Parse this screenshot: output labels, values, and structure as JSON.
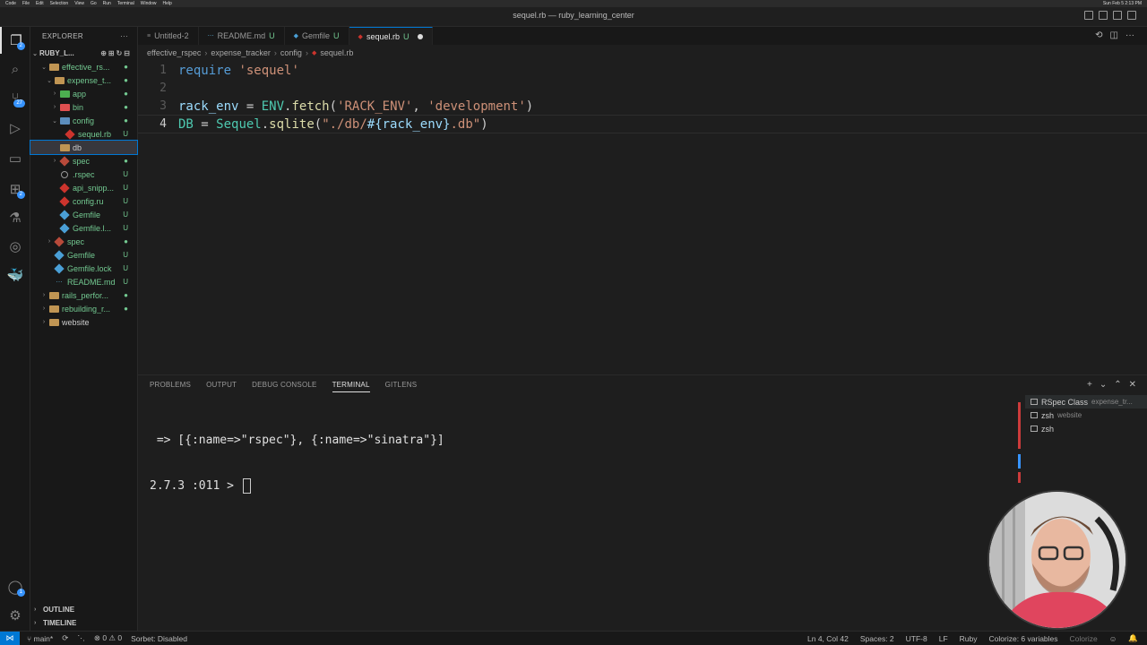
{
  "window": {
    "title": "sequel.rb — ruby_learning_center"
  },
  "menubar": {
    "items": [
      "Code",
      "File",
      "Edit",
      "Selection",
      "View",
      "Go",
      "Run",
      "Terminal",
      "Window",
      "Help"
    ],
    "clock": "Sun Feb 5 2:13 PM"
  },
  "activity": {
    "explorer_badge": "2",
    "scm_badge": "27",
    "accounts_badge": "1"
  },
  "sidebar": {
    "title": "EXPLORER",
    "root": "RUBY_L...",
    "tree": [
      {
        "label": "effective_rs...",
        "status": "●"
      },
      {
        "label": "expense_t...",
        "status": "●"
      },
      {
        "label": "app",
        "status": "●"
      },
      {
        "label": "bin",
        "status": "●"
      },
      {
        "label": "config",
        "status": "●"
      },
      {
        "label": "sequel.rb",
        "status": "U"
      },
      {
        "label": "db",
        "status": ""
      },
      {
        "label": "spec",
        "status": "●"
      },
      {
        "label": ".rspec",
        "status": "U"
      },
      {
        "label": "api_snipp...",
        "status": "U"
      },
      {
        "label": "config.ru",
        "status": "U"
      },
      {
        "label": "Gemfile",
        "status": "U"
      },
      {
        "label": "Gemfile.l...",
        "status": "U"
      },
      {
        "label": "spec",
        "status": "●"
      },
      {
        "label": "Gemfile",
        "status": "U"
      },
      {
        "label": "Gemfile.lock",
        "status": "U"
      },
      {
        "label": "README.md",
        "status": "U"
      },
      {
        "label": "rails_perfor...",
        "status": "●"
      },
      {
        "label": "rebuilding_r...",
        "status": "●"
      },
      {
        "label": "website",
        "status": ""
      }
    ],
    "outline": "OUTLINE",
    "timeline": "TIMELINE"
  },
  "tabs": [
    {
      "label": "Untitled-2",
      "status": ""
    },
    {
      "label": "README.md",
      "status": "U"
    },
    {
      "label": "Gemfile",
      "status": "U"
    },
    {
      "label": "sequel.rb",
      "status": "U"
    }
  ],
  "breadcrumb": [
    "effective_rspec",
    "expense_tracker",
    "config",
    "sequel.rb"
  ],
  "editor": {
    "line_numbers": [
      "1",
      "2",
      "3",
      "4"
    ],
    "l1": {
      "kw": "require",
      "str": "'sequel'"
    },
    "l3": {
      "var": "rack_env",
      "eq": " = ",
      "const": "ENV",
      "dot": ".",
      "fn": "fetch",
      "open": "(",
      "a1": "'RACK_ENV'",
      "comma": ", ",
      "a2": "'development'",
      "close": ")"
    },
    "l4": {
      "const1": "DB",
      "eq": " = ",
      "const2": "Sequel",
      "dot": ".",
      "fn": "sqlite",
      "open": "(",
      "s1": "\"./db/",
      "interp": "#{rack_env}",
      "s2": ".db\"",
      "close": ")"
    }
  },
  "panel": {
    "tabs": [
      "PROBLEMS",
      "OUTPUT",
      "DEBUG CONSOLE",
      "TERMINAL",
      "GITLENS"
    ],
    "terminal_lines": [
      " => [{:name=>\"rspec\"}, {:name=>\"sinatra\"}]",
      "2.7.3 :011 > "
    ],
    "terminals": [
      {
        "name": "RSpec Class",
        "sub": "expense_tr..."
      },
      {
        "name": "zsh",
        "sub": "website"
      },
      {
        "name": "zsh",
        "sub": ""
      }
    ]
  },
  "statusbar": {
    "branch": "main*",
    "problems": "⊗ 0 ⚠ 0",
    "sorbet": "Sorbet: Disabled",
    "position": "Ln 4, Col 42",
    "spaces": "Spaces: 2",
    "encoding": "UTF-8",
    "eol": "LF",
    "language": "Ruby",
    "colorize": "Colorize: 6 variables",
    "colorize_btn": "Colorize"
  }
}
